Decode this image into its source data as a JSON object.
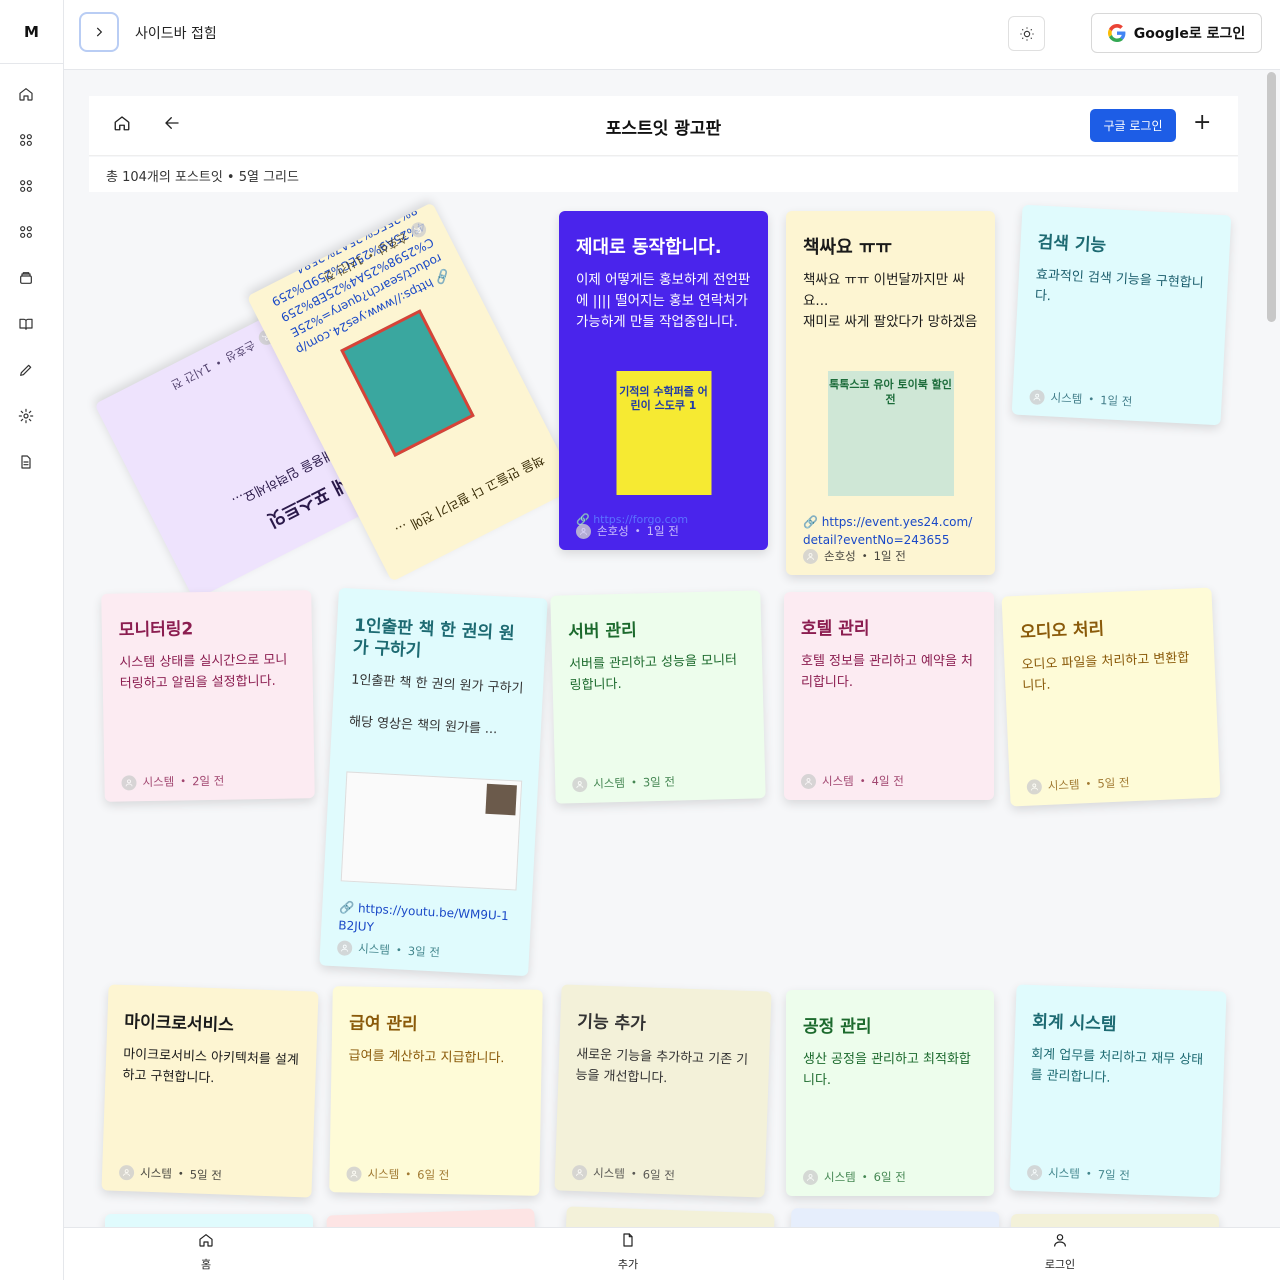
{
  "app": {
    "logo": "M"
  },
  "topbar": {
    "collapse_label": "사이드바 접힘",
    "login_label": "Google로 로그인"
  },
  "header": {
    "title": "포스트잇 광고판",
    "google_login": "구글 로그인",
    "add": "+",
    "summary": "총 104개의 포스트잇 • 5열 그리드"
  },
  "notes": [
    {
      "title": "새 포스트잇",
      "body": "내용을 입력하세요...",
      "author": "손호성",
      "time": "1시간 전"
    },
    {
      "title": "",
      "body": "책을 만들고 다 팔리기 전에 ...",
      "link": "🔗 https://www.yes24.com/product/search?query=%25EC%2598%25A4%25EB%2594%25A9%25EC%259D%2598%25EC%25A7%2584",
      "author": "손호성",
      "time": "1시간 전"
    },
    {
      "title": "제대로 동작합니다.",
      "body": "이제 어떻게든 홍보하게 전언판에 |||| 떨어지는 홍보 연락처가 가능하게 만들 작업중입니다.",
      "link": "🔗 https://forgo.com",
      "author": "손호성",
      "time": "1일 전",
      "image_text": "기적의 수학퍼즐 어린이 스도쿠 1"
    },
    {
      "title": "책싸요 ㅠㅠ",
      "body": "책싸요 ㅠㅠ 이번달까지만 싸요...\n재미로 싸게 팔았다가 망하겠음",
      "link": "🔗 https://event.yes24.com/detail?eventNo=243655",
      "author": "손호성",
      "time": "1일 전",
      "image_text": "톡톡스코 유아 토이북 할인전"
    },
    {
      "title": "검색 기능",
      "body": "효과적인 검색 기능을 구현합니다.",
      "author": "시스템",
      "time": "1일 전"
    },
    {
      "title": "모니터링2",
      "body": "시스템 상태를 실시간으로 모니터링하고 알림을 설정합니다.",
      "author": "시스템",
      "time": "2일 전"
    },
    {
      "title": "1인출판 책 한 권의 원가 구하기",
      "body": "1인출판 책 한 권의 원가 구하기\n\n해당 영상은 책의 원가를 ...",
      "link": "🔗 https://youtu.be/WM9U-1B2JUY",
      "author": "시스템",
      "time": "3일 전"
    },
    {
      "title": "서버 관리",
      "body": "서버를 관리하고 성능을 모니터링합니다.",
      "author": "시스템",
      "time": "3일 전"
    },
    {
      "title": "호텔 관리",
      "body": "호텔 정보를 관리하고 예약을 처리합니다.",
      "author": "시스템",
      "time": "4일 전"
    },
    {
      "title": "오디오 처리",
      "body": "오디오 파일을 처리하고 변환합니다.",
      "author": "시스템",
      "time": "5일 전"
    },
    {
      "title": "마이크로서비스",
      "body": "마이크로서비스 아키텍처를 설계하고 구현합니다.",
      "author": "시스템",
      "time": "5일 전"
    },
    {
      "title": "급여 관리",
      "body": "급여를 계산하고 지급합니다.",
      "author": "시스템",
      "time": "6일 전"
    },
    {
      "title": "기능 추가",
      "body": "새로운 기능을 추가하고 기존 기능을 개선합니다.",
      "author": "시스템",
      "time": "6일 전"
    },
    {
      "title": "공정 관리",
      "body": "생산 공정을 관리하고 최적화합니다.",
      "author": "시스템",
      "time": "6일 전"
    },
    {
      "title": "회계 시스템",
      "body": "회계 업무를 처리하고 재무 상태를 관리합니다.",
      "author": "시스템",
      "time": "7일 전"
    }
  ],
  "bottom_nav": {
    "home": "홈",
    "add": "추가",
    "login": "로그인"
  }
}
